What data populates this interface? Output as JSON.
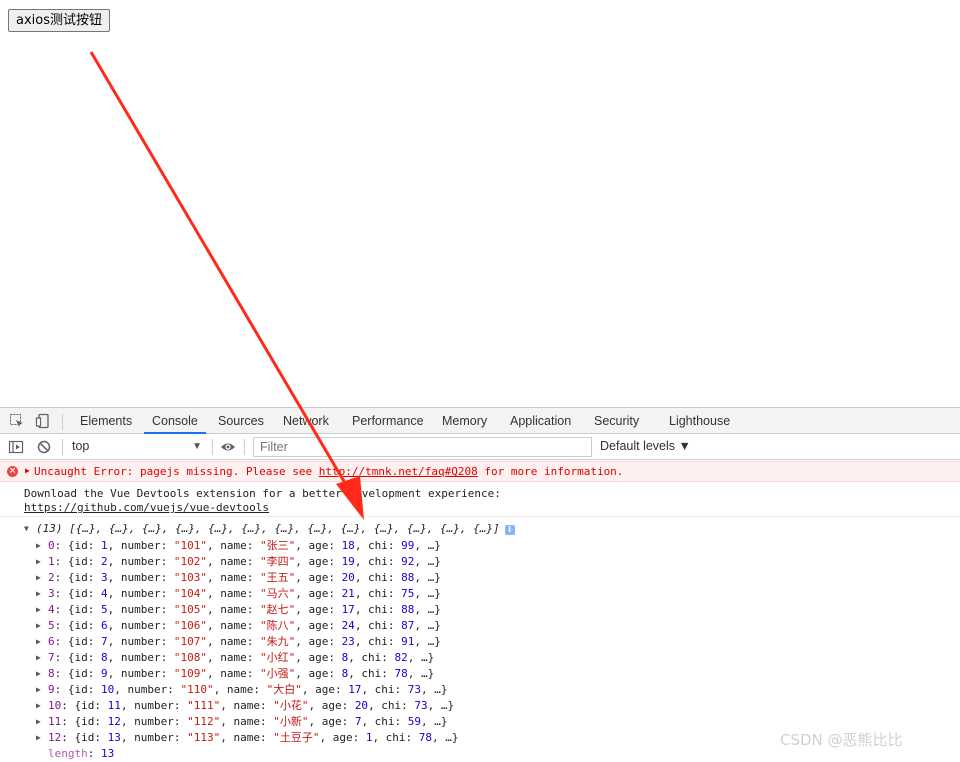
{
  "page": {
    "button_label": "axios测试按钮"
  },
  "devtools": {
    "tabs": [
      "Elements",
      "Console",
      "Sources",
      "Network",
      "Performance",
      "Memory",
      "Application",
      "Security",
      "Lighthouse"
    ],
    "active_tab": "Console",
    "toolbar": {
      "context": "top",
      "filter_placeholder": "Filter",
      "levels_label": "Default levels ▼"
    },
    "console": {
      "error": {
        "prefix": "Uncaught Error: pagejs missing. Please see ",
        "link": "http://tmnk.net/faq#Q208",
        "suffix": " for more information."
      },
      "vue_message": "Download the Vue Devtools extension for a better development experience:",
      "vue_link": "https://github.com/vuejs/vue-devtools",
      "array_summary": "(13) [{…}, {…}, {…}, {…}, {…}, {…}, {…}, {…}, {…}, {…}, {…}, {…}, {…}]",
      "items": [
        {
          "index": "0",
          "id": "1",
          "number": "\"101\"",
          "name": "\"张三\"",
          "age": "18",
          "chi": "99"
        },
        {
          "index": "1",
          "id": "2",
          "number": "\"102\"",
          "name": "\"李四\"",
          "age": "19",
          "chi": "92"
        },
        {
          "index": "2",
          "id": "3",
          "number": "\"103\"",
          "name": "\"王五\"",
          "age": "20",
          "chi": "88"
        },
        {
          "index": "3",
          "id": "4",
          "number": "\"104\"",
          "name": "\"马六\"",
          "age": "21",
          "chi": "75"
        },
        {
          "index": "4",
          "id": "5",
          "number": "\"105\"",
          "name": "\"赵七\"",
          "age": "17",
          "chi": "88"
        },
        {
          "index": "5",
          "id": "6",
          "number": "\"106\"",
          "name": "\"陈八\"",
          "age": "24",
          "chi": "87"
        },
        {
          "index": "6",
          "id": "7",
          "number": "\"107\"",
          "name": "\"朱九\"",
          "age": "23",
          "chi": "91"
        },
        {
          "index": "7",
          "id": "8",
          "number": "\"108\"",
          "name": "\"小红\"",
          "age": "8",
          "chi": "82"
        },
        {
          "index": "8",
          "id": "9",
          "number": "\"109\"",
          "name": "\"小强\"",
          "age": "8",
          "chi": "78"
        },
        {
          "index": "9",
          "id": "10",
          "number": "\"110\"",
          "name": "\"大白\"",
          "age": "17",
          "chi": "73"
        },
        {
          "index": "10",
          "id": "11",
          "number": "\"111\"",
          "name": "\"小花\"",
          "age": "20",
          "chi": "73"
        },
        {
          "index": "11",
          "id": "12",
          "number": "\"112\"",
          "name": "\"小新\"",
          "age": "7",
          "chi": "59"
        },
        {
          "index": "12",
          "id": "13",
          "number": "\"113\"",
          "name": "\"土豆子\"",
          "age": "1",
          "chi": "78"
        }
      ],
      "length_key": "length",
      "length_value": "13"
    }
  },
  "annotation": {
    "arrow_color": "#ff2a1a"
  },
  "watermark": "CSDN @恶熊比比"
}
